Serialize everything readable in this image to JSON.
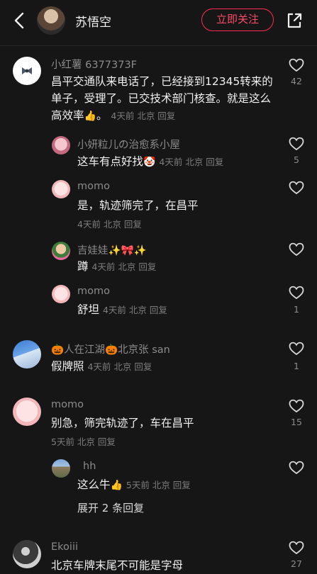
{
  "header": {
    "username": "苏悟空",
    "follow_label": "立即关注"
  },
  "comments": [
    {
      "name": "小红薯 6377373F",
      "text": "昌平交通队来电话了，已经接到12345转来的单子，受理了。已交技术部门核查。就是这么高效率",
      "emoji": "👍",
      "meta": "4天前 北京 回复",
      "likes": "42",
      "replies": [
        {
          "name": "小妍粒儿の治愈系小屋",
          "text": "这车有点好找",
          "emoji": "🤡",
          "meta": "4天前 北京 回复",
          "likes": "5"
        },
        {
          "name": "momo",
          "text": "是，轨迹筛完了，在昌平",
          "meta": "4天前 北京 回复",
          "likes": ""
        },
        {
          "name": "吉娃娃✨🎀✨",
          "text": "蹲",
          "meta": "4天前 北京 回复",
          "likes": ""
        },
        {
          "name": "momo",
          "text": "舒坦",
          "meta": "4天前 北京 回复",
          "likes": "1"
        }
      ]
    },
    {
      "name": "🎃人在江湖🎃北京张 san",
      "text": "假牌照",
      "meta": "4天前 北京 回复",
      "likes": "1"
    },
    {
      "name": "momo",
      "text": "别急，筛完轨迹了，车在昌平",
      "meta": "5天前 北京 回复",
      "likes": "15",
      "replies": [
        {
          "name": "hh",
          "text": "这么牛",
          "emoji": "👍",
          "meta": "5天前 北京 回复",
          "likes": ""
        }
      ],
      "expand_label": "展开 2 条回复"
    },
    {
      "name": "Ekoiii",
      "text": "北京车牌末尾不可能是字母",
      "likes": "27"
    }
  ],
  "colors": {
    "accent": "#fe2c55",
    "background": "#161616",
    "muted": "#7d7d7d"
  }
}
